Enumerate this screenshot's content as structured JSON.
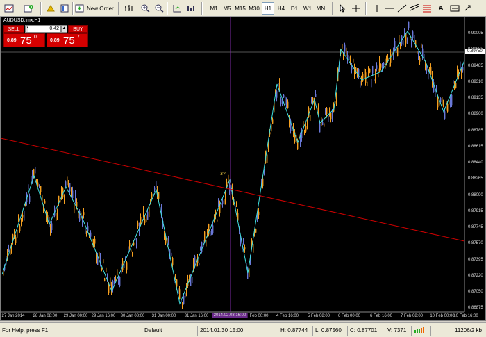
{
  "toolbar": {
    "new_order_label": "New Order",
    "periods": [
      "M1",
      "M5",
      "M15",
      "M30",
      "H1",
      "H4",
      "D1",
      "W1",
      "MN"
    ],
    "active_period": "H1"
  },
  "chart": {
    "window_title": "AUDUSD.lmx,H1",
    "annotation": "3?",
    "current_price": "0.89750",
    "price_labels": [
      "0.90005",
      "0.89655",
      "0.89485",
      "0.89310",
      "0.89135",
      "0.88960",
      "0.88785",
      "0.88615",
      "0.88440",
      "0.88265",
      "0.88090",
      "0.87915",
      "0.87745",
      "0.87570",
      "0.87395",
      "0.87220",
      "0.87050",
      "0.86875"
    ],
    "date_labels": [
      "27 Jan 2014",
      "28 Jan 08:00",
      "29 Jan 00:00",
      "29 Jan 16:00",
      "30 Jan 08:00",
      "31 Jan 00:00",
      "31 Jan 16:00",
      "2014.02.03 16:00",
      "Feb 00:00",
      "4 Feb 16:00",
      "5 Feb 08:00",
      "6 Feb 00:00",
      "6 Feb 16:00",
      "7 Feb 08:00",
      "10 Feb 00:00",
      "10 Feb 16:00"
    ],
    "highlighted_date": "2014.02.03 16:00",
    "colors": {
      "background": "#000000",
      "bull": "#6a78d8",
      "bear": "#f5a020",
      "zigzag": "#40e0e0",
      "trendline": "#cc0000",
      "vline": "#7a2aa0"
    }
  },
  "one_click": {
    "sell_label": "SELL",
    "buy_label": "BUY",
    "lot": "0.42",
    "sell_prefix": "0.89",
    "sell_big": "75",
    "sell_sup": "0",
    "buy_prefix": "0.89",
    "buy_big": "75",
    "buy_sup": "7"
  },
  "status": {
    "help": "For Help, press F1",
    "profile": "Default",
    "datetime": "2014.01.30 15:00",
    "high": "H: 0.87744",
    "low": "L: 0.87560",
    "close": "C: 0.87701",
    "volume": "V: 7371",
    "traffic": "11206/2 kb"
  }
}
